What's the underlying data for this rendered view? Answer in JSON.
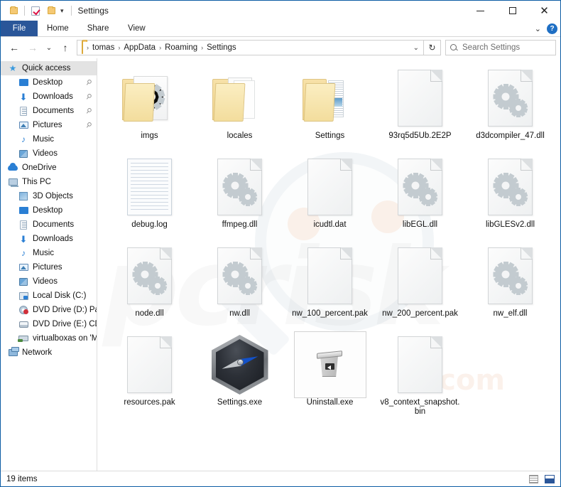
{
  "window": {
    "title": "Settings",
    "quick_access_icons": [
      "folder-icon",
      "properties-icon",
      "new-folder-icon"
    ],
    "quick_access_caret": "▾",
    "controls": {
      "minimize": "—",
      "maximize": "▢",
      "close": "✕",
      "ribbon_expand": "⌄",
      "help": "?"
    }
  },
  "ribbon": {
    "tabs": [
      {
        "label": "File",
        "active": true
      },
      {
        "label": "Home",
        "active": false
      },
      {
        "label": "Share",
        "active": false
      },
      {
        "label": "View",
        "active": false
      }
    ]
  },
  "addressbar": {
    "back": "←",
    "forward": "→",
    "recent": "⌄",
    "up": "↑",
    "crumbs": [
      "tomas",
      "AppData",
      "Roaming",
      "Settings"
    ],
    "crumb_sep": "›",
    "dropdown_caret": "⌄",
    "refresh": "↻"
  },
  "search": {
    "icon": "search-icon",
    "placeholder": "Search Settings",
    "value": ""
  },
  "sidebar": {
    "items": [
      {
        "label": "Quick access",
        "icon": "star-icon",
        "level": 0,
        "selected": true,
        "pinned": false
      },
      {
        "label": "Desktop",
        "icon": "desktop-icon",
        "level": 1,
        "selected": false,
        "pinned": true
      },
      {
        "label": "Downloads",
        "icon": "downloads-icon",
        "level": 1,
        "selected": false,
        "pinned": true
      },
      {
        "label": "Documents",
        "icon": "documents-icon",
        "level": 1,
        "selected": false,
        "pinned": true
      },
      {
        "label": "Pictures",
        "icon": "pictures-icon",
        "level": 1,
        "selected": false,
        "pinned": true
      },
      {
        "label": "Music",
        "icon": "music-icon",
        "level": 1,
        "selected": false,
        "pinned": false
      },
      {
        "label": "Videos",
        "icon": "videos-icon",
        "level": 1,
        "selected": false,
        "pinned": false
      },
      {
        "label": "OneDrive",
        "icon": "cloud-icon",
        "level": 0,
        "selected": false,
        "pinned": false
      },
      {
        "label": "This PC",
        "icon": "this-pc-icon",
        "level": 0,
        "selected": false,
        "pinned": false
      },
      {
        "label": "3D Objects",
        "icon": "3d-objects-icon",
        "level": 1,
        "selected": false,
        "pinned": false
      },
      {
        "label": "Desktop",
        "icon": "desktop-icon",
        "level": 1,
        "selected": false,
        "pinned": false
      },
      {
        "label": "Documents",
        "icon": "documents-icon",
        "level": 1,
        "selected": false,
        "pinned": false
      },
      {
        "label": "Downloads",
        "icon": "downloads-icon",
        "level": 1,
        "selected": false,
        "pinned": false
      },
      {
        "label": "Music",
        "icon": "music-icon",
        "level": 1,
        "selected": false,
        "pinned": false
      },
      {
        "label": "Pictures",
        "icon": "pictures-icon",
        "level": 1,
        "selected": false,
        "pinned": false
      },
      {
        "label": "Videos",
        "icon": "videos-icon",
        "level": 1,
        "selected": false,
        "pinned": false
      },
      {
        "label": "Local Disk (C:)",
        "icon": "local-disk-icon",
        "level": 1,
        "selected": false,
        "pinned": false
      },
      {
        "label": "DVD Drive (D:) Paral",
        "icon": "dvd-drive-icon",
        "level": 1,
        "selected": false,
        "pinned": false
      },
      {
        "label": "DVD Drive (E:) CDRO",
        "icon": "dvd-drive-icon",
        "level": 1,
        "selected": false,
        "pinned": false
      },
      {
        "label": "virtualboxas on 'Ma",
        "icon": "network-drive-icon",
        "level": 1,
        "selected": false,
        "pinned": false
      },
      {
        "label": "Network",
        "icon": "network-icon",
        "level": 0,
        "selected": false,
        "pinned": false
      }
    ]
  },
  "files": [
    {
      "name": "imgs",
      "icon": "folder-gear-icon",
      "selected": false
    },
    {
      "name": "locales",
      "icon": "folder-docs-icon",
      "selected": false
    },
    {
      "name": "Settings",
      "icon": "folder-stack-icon",
      "selected": false
    },
    {
      "name": "93rq5d5Ub.2E2P",
      "icon": "blank-file-icon",
      "selected": false
    },
    {
      "name": "d3dcompiler_47.dll",
      "icon": "dll-file-icon",
      "selected": false
    },
    {
      "name": "debug.log",
      "icon": "log-file-icon",
      "selected": false
    },
    {
      "name": "ffmpeg.dll",
      "icon": "dll-file-icon",
      "selected": false
    },
    {
      "name": "icudtl.dat",
      "icon": "blank-file-icon",
      "selected": false
    },
    {
      "name": "libEGL.dll",
      "icon": "dll-file-icon",
      "selected": false
    },
    {
      "name": "libGLESv2.dll",
      "icon": "dll-file-icon",
      "selected": false
    },
    {
      "name": "node.dll",
      "icon": "dll-file-icon",
      "selected": false
    },
    {
      "name": "nw.dll",
      "icon": "dll-file-icon",
      "selected": false
    },
    {
      "name": "nw_100_percent.pak",
      "icon": "blank-file-icon",
      "selected": false
    },
    {
      "name": "nw_200_percent.pak",
      "icon": "blank-file-icon",
      "selected": false
    },
    {
      "name": "nw_elf.dll",
      "icon": "dll-file-icon",
      "selected": false
    },
    {
      "name": "resources.pak",
      "icon": "blank-file-icon",
      "selected": false
    },
    {
      "name": "Settings.exe",
      "icon": "compass-hex-icon",
      "selected": false
    },
    {
      "name": "Uninstall.exe",
      "icon": "trash-icon",
      "selected": true
    },
    {
      "name": "v8_context_snapshot.bin",
      "icon": "blank-file-icon",
      "selected": false
    }
  ],
  "statusbar": {
    "item_count": "19 items",
    "view_details_icon": "details-view-icon",
    "view_large_icon": "large-icons-view-icon"
  },
  "watermark": {
    "main": "pcrisk",
    "sub": ".com"
  },
  "colors": {
    "window_border": "#0c5ca4",
    "active_tab": "#2a5699",
    "selection": "#e3e3e3",
    "folder_yellow": "#f3dd9d",
    "help_blue": "#1f6fc4"
  }
}
